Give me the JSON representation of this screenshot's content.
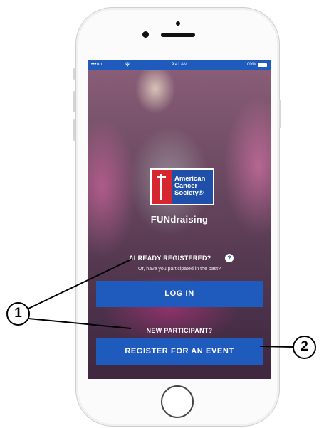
{
  "status_bar": {
    "signal": "•••oo",
    "wifi_icon": "wifi-icon",
    "time": "9:41 AM",
    "battery": "100%"
  },
  "logo": {
    "line1": "American",
    "line2": "Cancer",
    "line3": "Society®"
  },
  "app": {
    "title": "FUNdraising"
  },
  "login_section": {
    "already_registered": "ALREADY REGISTERED?",
    "help_icon_glyph": "?",
    "participated_text": "Or, have you participated in the past?",
    "login_button": "LOG IN"
  },
  "register_section": {
    "new_participant": "NEW PARTICIPANT?",
    "register_button": "REGISTER FOR AN EVENT"
  },
  "callouts": {
    "one": "1",
    "two": "2"
  },
  "colors": {
    "brand_blue": "#1f5bbd",
    "acs_red": "#d6262f",
    "acs_blue": "#1f4fa8"
  }
}
